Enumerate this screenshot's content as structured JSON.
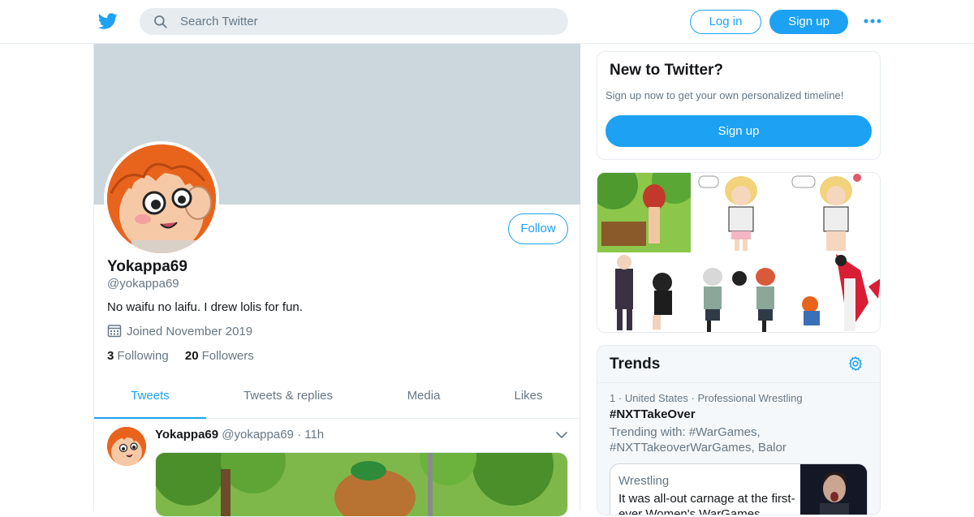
{
  "topbar": {
    "search_placeholder": "Search Twitter",
    "login_label": "Log in",
    "signup_label": "Sign up",
    "brand_color": "#1da1f2",
    "logo_icon": "twitter-bird-icon",
    "more_icon": "more-dots-icon"
  },
  "profile": {
    "name": "Yokappa69",
    "handle": "@yokappa69",
    "bio": "No waifu no laifu. I drew lolis for fun.",
    "joined": "Joined November 2019",
    "following_count": "3",
    "following_label": "Following",
    "followers_count": "20",
    "followers_label": "Followers",
    "follow_label": "Follow"
  },
  "tabs": [
    {
      "label": "Tweets",
      "active": true
    },
    {
      "label": "Tweets & replies",
      "active": false
    },
    {
      "label": "Media",
      "active": false
    },
    {
      "label": "Likes",
      "active": false
    }
  ],
  "tweet": {
    "name": "Yokappa69",
    "handle": "@yokappa69",
    "separator": "·",
    "time": "11h"
  },
  "sidebar": {
    "new_title": "New to Twitter?",
    "new_sub": "Sign up now to get your own personalized timeline!",
    "new_button": "Sign up"
  },
  "trends": {
    "title": "Trends",
    "rank": "1",
    "dot": "·",
    "location": "United States",
    "category": "Professional Wrestling",
    "tag": "#NXTTakeOver",
    "trending_with": "Trending with: #WarGames, #NXTTakeoverWarGames, Balor",
    "story_category": "Wrestling",
    "story_text": "It was all-out carnage at the first-ever Women's WarGames"
  }
}
